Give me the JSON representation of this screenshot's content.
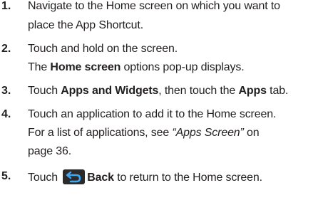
{
  "steps": [
    {
      "number": "1.",
      "line1": "Navigate to the Home screen on which you want to",
      "line2": "place the App Shortcut."
    },
    {
      "number": "2.",
      "line1": "Touch and hold on the screen.",
      "line2_bold": "Home screen",
      "line2_rest": " options pop-up displays.",
      "line2_pre": "The "
    },
    {
      "number": "3.",
      "pre": "Touch ",
      "bold1": "Apps and Widgets",
      "mid": ", then touch the ",
      "bold2": "Apps",
      "post": " tab."
    },
    {
      "number": "4.",
      "line1": "Touch an application to add it to the Home screen.",
      "line2_pre": "For a list of applications, see ",
      "line2_ref": "“Apps Screen”",
      "line2_post": " on",
      "line3": "page 36."
    },
    {
      "number": "5.",
      "pre": "Touch ",
      "icon": "back-arrow-icon",
      "bold": "Back",
      "post": " to return to the Home screen."
    }
  ],
  "colors": {
    "text": "#231f20",
    "icon_bg": "#2b2b2b",
    "icon_arrow": "#3fa9f5"
  }
}
